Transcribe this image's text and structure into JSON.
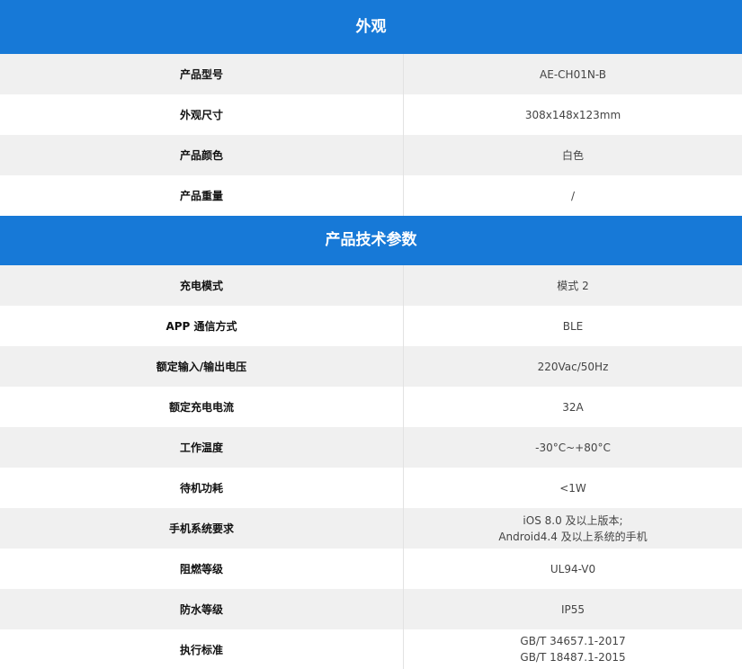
{
  "sections": [
    {
      "title": "外观",
      "rows": [
        {
          "label": "产品型号",
          "values": [
            "AE-CH01N-B"
          ]
        },
        {
          "label": "外观尺寸",
          "values": [
            "308x148x123mm"
          ]
        },
        {
          "label": "产品颜色",
          "values": [
            "白色"
          ]
        },
        {
          "label": "产品重量",
          "values": [
            "/"
          ]
        }
      ]
    },
    {
      "title": "产品技术参数",
      "rows": [
        {
          "label": "充电模式",
          "values": [
            "模式 2"
          ]
        },
        {
          "label": "APP 通信方式",
          "values": [
            "BLE"
          ]
        },
        {
          "label": "额定输入/输出电压",
          "values": [
            "220Vac/50Hz"
          ]
        },
        {
          "label": "额定充电电流",
          "values": [
            "32A"
          ]
        },
        {
          "label": "工作温度",
          "values": [
            "-30°C~+80°C"
          ]
        },
        {
          "label": "待机功耗",
          "values": [
            "<1W"
          ]
        },
        {
          "label": "手机系统要求",
          "values": [
            "iOS 8.0 及以上版本;",
            "Android4.4 及以上系统的手机"
          ]
        },
        {
          "label": "阻燃等级",
          "values": [
            "UL94-V0"
          ]
        },
        {
          "label": "防水等级",
          "values": [
            "IP55"
          ]
        },
        {
          "label": "执行标准",
          "values": [
            "GB/T 34657.1-2017",
            "GB/T 18487.1-2015"
          ]
        }
      ]
    }
  ]
}
